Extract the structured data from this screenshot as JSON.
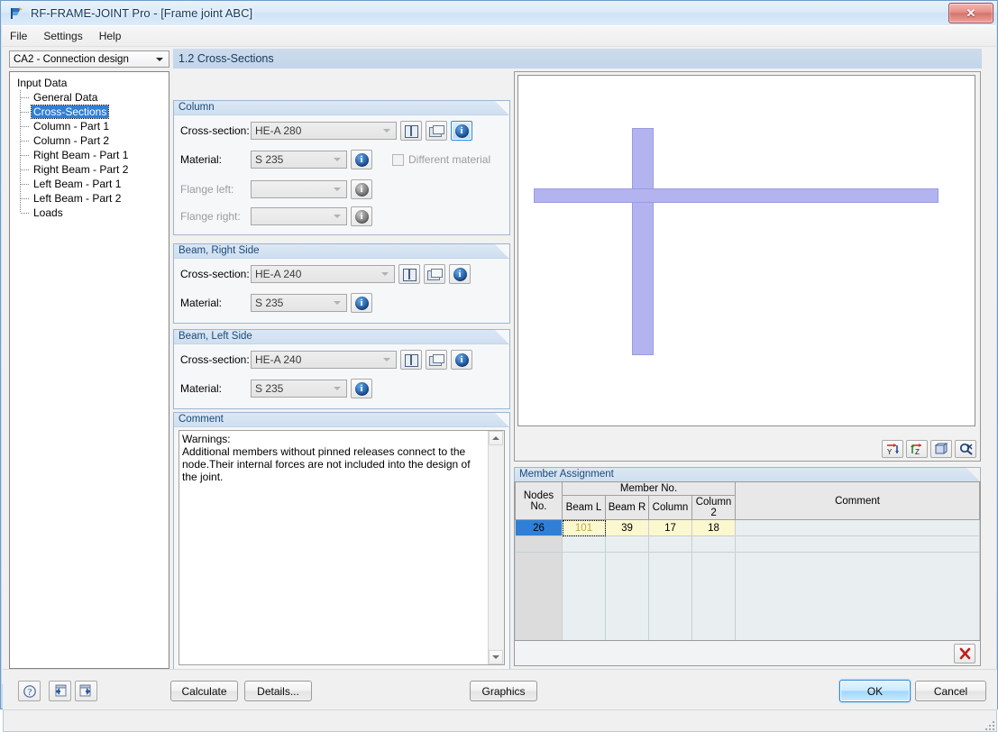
{
  "window": {
    "title": "RF-FRAME-JOINT Pro - [Frame joint ABC]",
    "icon": "app-icon",
    "close_label": "✕"
  },
  "menu": {
    "items": [
      {
        "label": "File"
      },
      {
        "label": "Settings"
      },
      {
        "label": "Help"
      }
    ]
  },
  "nav": {
    "combo_value": "CA2 - Connection design"
  },
  "tree": {
    "root": "Input Data",
    "items": [
      {
        "label": "General Data",
        "selected": false
      },
      {
        "label": "Cross-Sections",
        "selected": true
      },
      {
        "label": "Column - Part 1",
        "selected": false
      },
      {
        "label": "Column - Part 2",
        "selected": false
      },
      {
        "label": "Right Beam - Part 1",
        "selected": false
      },
      {
        "label": "Right Beam - Part 2",
        "selected": false
      },
      {
        "label": "Left Beam - Part 1",
        "selected": false
      },
      {
        "label": "Left Beam - Part 2",
        "selected": false
      },
      {
        "label": "Loads",
        "selected": false
      }
    ]
  },
  "pane": {
    "title": "1.2 Cross-Sections"
  },
  "column_group": {
    "title": "Column",
    "cross_section_label": "Cross-section:",
    "cross_section_value": "HE-A 280",
    "material_label": "Material:",
    "material_value": "S 235",
    "different_material_label": "Different material",
    "different_material_checked": false,
    "flange_left_label": "Flange left:",
    "flange_left_value": "",
    "flange_right_label": "Flange right:",
    "flange_right_value": ""
  },
  "beam_right_group": {
    "title": "Beam, Right Side",
    "cross_section_label": "Cross-section:",
    "cross_section_value": "HE-A 240",
    "material_label": "Material:",
    "material_value": "S 235"
  },
  "beam_left_group": {
    "title": "Beam, Left Side",
    "cross_section_label": "Cross-section:",
    "cross_section_value": "HE-A 240",
    "material_label": "Material:",
    "material_value": "S 235"
  },
  "comment_group": {
    "title": "Comment",
    "text": "Warnings:\nAdditional members without pinned releases connect to the node.Their internal forces are not included into the design of the joint."
  },
  "graphics": {
    "member_color": "#b3b3f0",
    "toolbar": [
      {
        "name": "view-in-y-icon",
        "label": "Y"
      },
      {
        "name": "view-in-z-icon",
        "label": "Z"
      },
      {
        "name": "isometric-view-icon",
        "label": ""
      },
      {
        "name": "zoom-all-icon",
        "label": ""
      }
    ]
  },
  "member_assignment": {
    "title": "Member Assignment",
    "group_header": "Member No.",
    "columns": [
      "Nodes No.",
      "Beam L",
      "Beam R",
      "Column",
      "Column 2",
      "Comment"
    ],
    "rows": [
      {
        "node": "26",
        "beam_l": "101",
        "beam_r": "39",
        "column": "17",
        "column2": "18",
        "comment": ""
      }
    ],
    "delete_label": "✗"
  },
  "bottom": {
    "help_icon": "help-icon",
    "prev_icon": "previous-icon",
    "next_icon": "next-icon",
    "calculate": "Calculate",
    "details": "Details...",
    "graphics": "Graphics",
    "ok": "OK",
    "cancel": "Cancel"
  },
  "status": {
    "text": ""
  }
}
